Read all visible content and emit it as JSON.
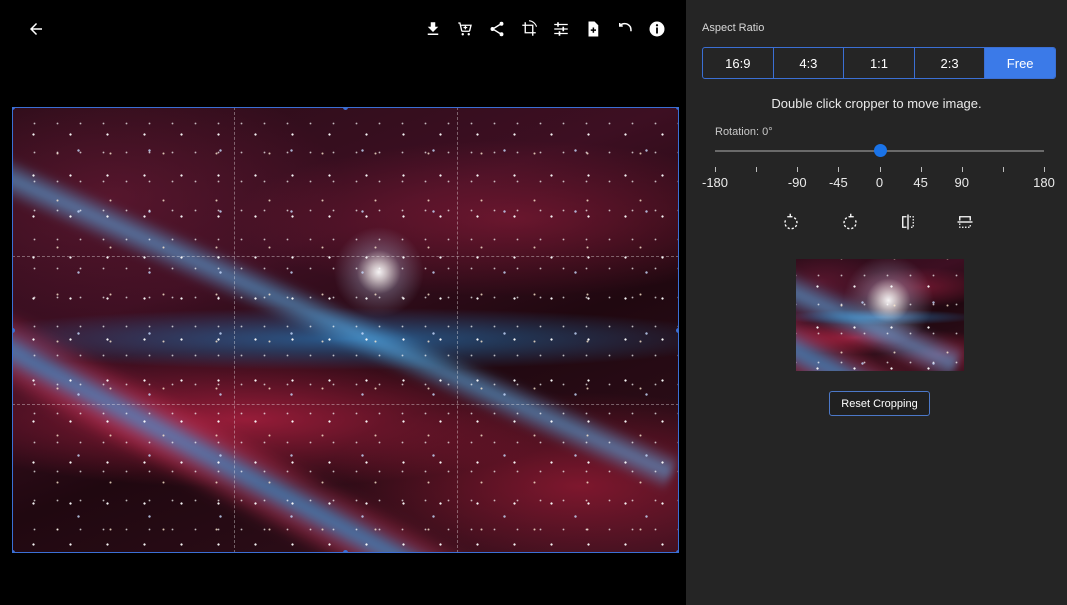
{
  "toolbar": {
    "icons": [
      "download-icon",
      "cart-icon",
      "share-icon",
      "crop-icon",
      "adjust-icon",
      "add-file-icon",
      "undo-icon",
      "info-icon"
    ]
  },
  "panel": {
    "aspect_ratio_label": "Aspect Ratio",
    "ratios": [
      {
        "label": "16:9",
        "active": false
      },
      {
        "label": "4:3",
        "active": false
      },
      {
        "label": "1:1",
        "active": false
      },
      {
        "label": "2:3",
        "active": false
      },
      {
        "label": "Free",
        "active": true
      }
    ],
    "hint": "Double click cropper to move image.",
    "rotation": {
      "label": "Rotation: 0°",
      "value": 0,
      "min": -180,
      "max": 180,
      "ticks": [
        "-180",
        "",
        "-90",
        "-45",
        "0",
        "45",
        "90",
        "",
        "180"
      ]
    },
    "tools": [
      "rotate-left-icon",
      "rotate-right-icon",
      "flip-horizontal-icon",
      "flip-vertical-icon"
    ],
    "reset_label": "Reset Cropping"
  },
  "colors": {
    "accent": "#3b7ae8",
    "panel_bg": "#252525",
    "viewer_bg": "#000000",
    "slider_thumb": "#1a73e8"
  }
}
